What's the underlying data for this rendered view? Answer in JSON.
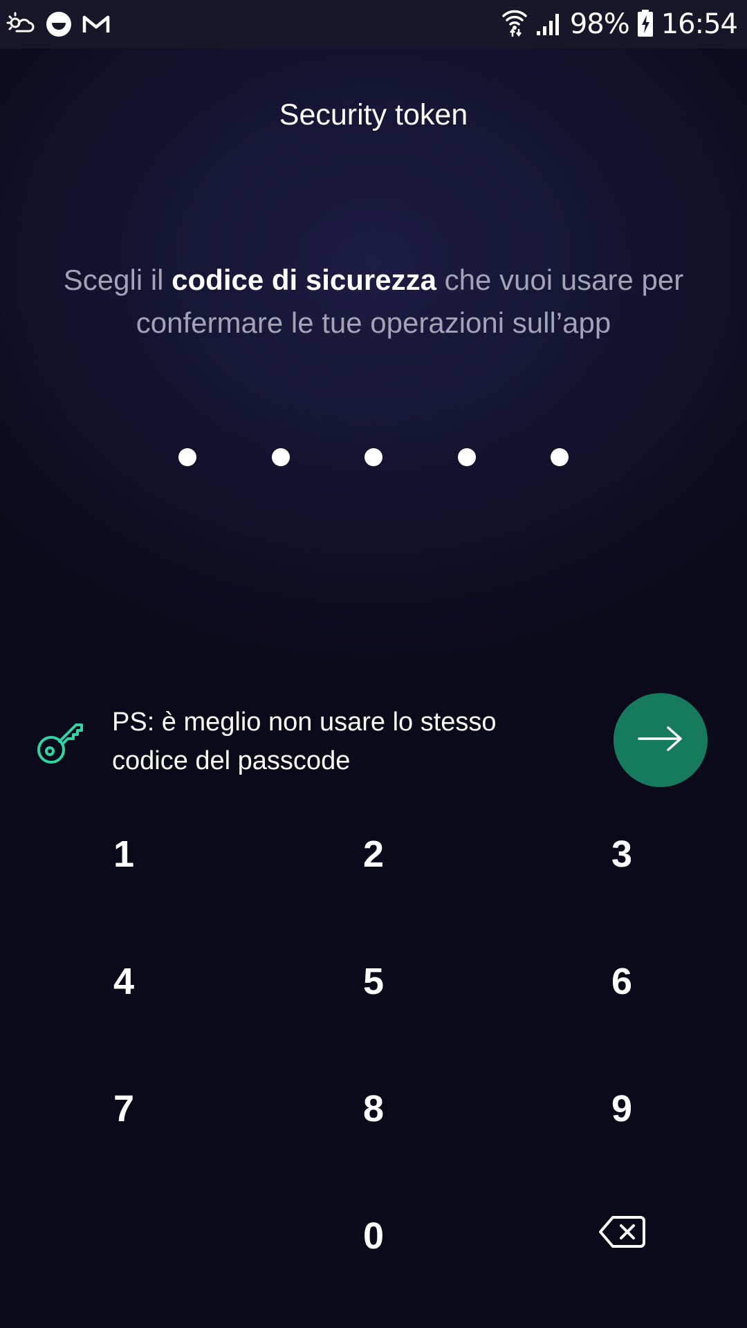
{
  "status_bar": {
    "battery_percent": "98%",
    "time": "16:54",
    "icons": [
      "weather-icon",
      "messenger-icon",
      "gmail-icon",
      "wifi-icon",
      "signal-icon",
      "battery-charging-icon"
    ]
  },
  "header": {
    "title": "Security token"
  },
  "instruction": {
    "prefix": "Scegli il ",
    "bold": "codice di sicurezza",
    "suffix": " che vuoi usare per confermare le tue operazioni sull’app"
  },
  "pin": {
    "length": 5,
    "filled": 5
  },
  "hint": {
    "text": "PS: è meglio non usare lo stesso codice del passcode",
    "icon": "key-icon"
  },
  "next_button": {
    "icon": "arrow-right-icon",
    "color": "#167a5c"
  },
  "keypad": {
    "keys": [
      "1",
      "2",
      "3",
      "4",
      "5",
      "6",
      "7",
      "8",
      "9",
      "0"
    ],
    "delete_icon": "backspace-icon"
  },
  "colors": {
    "background": "#12122c",
    "accent": "#2fd6a4",
    "button": "#167a5c",
    "muted_text": "#a3a3b8"
  }
}
